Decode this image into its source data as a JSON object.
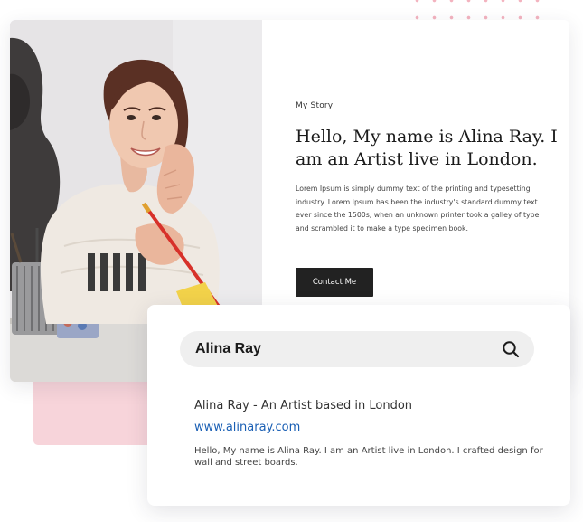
{
  "story": {
    "eyebrow": "My Story",
    "headline": "Hello, My name is Alina Ray. I am an Artist live in London.",
    "body": "Lorem Ipsum is simply dummy text of the printing and typesetting industry. Lorem Ipsum has been the industry's standard dummy text ever since the 1500s, when an unknown printer took a galley of type and scrambled it to make a type specimen book.",
    "contact_label": "Contact Me",
    "photo_icon": "portrait-photo"
  },
  "search": {
    "query": "Alina Ray",
    "icon": "search-icon",
    "result": {
      "title": "Alina Ray - An Artist based in London",
      "url": "www.alinaray.com",
      "snippet": "Hello, My name is Alina Ray. I am an Artist live in London. I crafted design for wall and street boards."
    }
  },
  "colors": {
    "accent_pink": "#f7d4da",
    "dot_pink": "#f3b3bf",
    "button_dark": "#222222",
    "link_blue": "#1a5fb4"
  }
}
